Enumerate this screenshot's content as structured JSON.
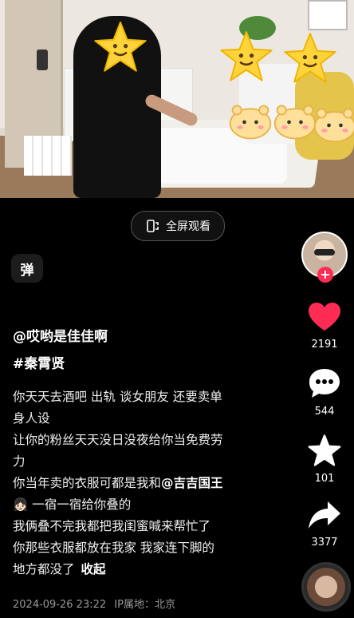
{
  "video": {
    "fullscreen_label": "全屏观看"
  },
  "danmaku": {
    "label": "弹"
  },
  "post": {
    "author": "@哎哟是佳佳啊",
    "hashtag": "#秦霄贤",
    "lines": [
      "你天天去酒吧 出轨 谈女朋友 还要卖单",
      "身人设",
      "让你的粉丝天天没日没夜给你当免费劳",
      "力",
      "你当年卖的衣服可都是我和",
      "一宿一宿给你叠的",
      "我俩叠不完我都把我闺蜜喊来帮忙了",
      "你那些衣服都放在我家 我家连下脚的",
      "地方都没了"
    ],
    "mention": "@吉吉国王",
    "mention_emoji": "👧🏻",
    "fold_label": "收起",
    "timestamp": "2024-09-26 23:22",
    "ip_location": "IP属地：北京"
  },
  "actions": {
    "likes": "2191",
    "comments": "544",
    "favorites": "101",
    "shares": "3377"
  },
  "icons": [
    "danmaku-icon",
    "fullscreen-icon",
    "avatar",
    "follow-plus-icon",
    "heart-icon",
    "comment-icon",
    "star-icon",
    "share-icon",
    "music-disc"
  ],
  "colors": {
    "like": "#fe2c55",
    "background": "#000000"
  }
}
